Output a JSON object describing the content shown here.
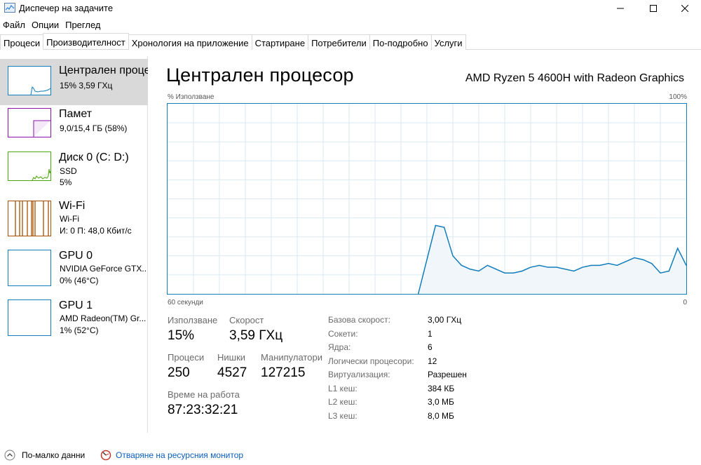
{
  "window": {
    "title": "Диспечер на задачите",
    "controls": [
      "minimize-icon",
      "maximize-icon",
      "close-icon"
    ]
  },
  "menu": [
    "Файл",
    "Опции",
    "Преглед"
  ],
  "tabs": [
    {
      "label": "Процеси",
      "active": false
    },
    {
      "label": "Производителност",
      "active": true
    },
    {
      "label": "Хронология на приложение",
      "active": false
    },
    {
      "label": "Стартиране",
      "active": false
    },
    {
      "label": "Потребители",
      "active": false
    },
    {
      "label": "По-подробно",
      "active": false
    },
    {
      "label": "Услуги",
      "active": false
    }
  ],
  "sidebar": {
    "items": [
      {
        "title": "Централен процесор",
        "line1": "15%  3,59 ГХц",
        "line2": "",
        "color": "#117dbb",
        "selected": true
      },
      {
        "title": "Памет",
        "line1": "9,0/15,4 ГБ (58%)",
        "line2": "",
        "color": "#8b12ae",
        "selected": false
      },
      {
        "title": "Диск 0 (C: D:)",
        "line1": "SSD",
        "line2": "5%",
        "color": "#4da60c",
        "selected": false
      },
      {
        "title": "Wi-Fi",
        "line1": "Wi-Fi",
        "line2": "И: 0 П: 48,0 Кбит/с",
        "color": "#a74f01",
        "selected": false
      },
      {
        "title": "GPU 0",
        "line1": "NVIDIA GeForce GTX...",
        "line2": "0%  (46°C)",
        "color": "#117dbb",
        "selected": false
      },
      {
        "title": "GPU 1",
        "line1": "AMD Radeon(TM) Gr...",
        "line2": "1%  (52°C)",
        "color": "#117dbb",
        "selected": false
      }
    ]
  },
  "main": {
    "title": "Централен процесор",
    "cpu_name": "AMD Ryzen 5 4600H with Radeon Graphics",
    "graph": {
      "y_label": "% Използване",
      "y_max_label": "100%",
      "x_left_label": "60 секунди",
      "x_right_label": "0",
      "line_color": "#117dbb",
      "fill_color": "#f1f6fa",
      "grid_color": "#d9eaf4"
    },
    "stats": {
      "usage_label": "Използване",
      "usage_value": "15%",
      "speed_label": "Скорост",
      "speed_value": "3,59 ГХц",
      "processes_label": "Процеси",
      "processes_value": "250",
      "threads_label": "Нишки",
      "threads_value": "4527",
      "handles_label": "Манипулатори",
      "handles_value": "127215",
      "uptime_label": "Време на работа",
      "uptime_value": "87:23:32:21"
    },
    "specs": [
      {
        "label": "Базова скорост:",
        "value": "3,00 ГХц"
      },
      {
        "label": "Сокети:",
        "value": "1"
      },
      {
        "label": "Ядра:",
        "value": "6"
      },
      {
        "label": "Логически процесори:",
        "value": "12"
      },
      {
        "label": "Виртуализация:",
        "value": "Разрешен"
      },
      {
        "label": "L1 кеш:",
        "value": "384 КБ"
      },
      {
        "label": "L2 кеш:",
        "value": "3,0 МБ"
      },
      {
        "label": "L3 кеш:",
        "value": "8,0 МБ"
      }
    ]
  },
  "chart_data": {
    "type": "area",
    "x_unit": "seconds ago",
    "x_range": [
      60,
      0
    ],
    "ylim": [
      0,
      100
    ],
    "ylabel": "% Използване",
    "x": [
      60,
      56,
      52,
      48,
      44,
      40,
      36,
      33,
      32,
      31,
      30,
      29,
      28,
      27,
      26,
      25,
      24,
      23,
      22,
      21,
      20,
      19,
      18,
      17,
      16,
      15,
      14,
      13,
      12,
      11,
      10,
      9,
      8,
      7,
      6,
      5,
      4,
      3,
      2,
      1,
      0
    ],
    "values": [
      null,
      null,
      null,
      null,
      null,
      null,
      null,
      null,
      null,
      0,
      18,
      36,
      35,
      20,
      15,
      13,
      12,
      15,
      13,
      11,
      11,
      12,
      14,
      15,
      14,
      14,
      13,
      12,
      14,
      15,
      15,
      16,
      15,
      17,
      19,
      18,
      16,
      11,
      12,
      24,
      15
    ]
  },
  "footer": {
    "fewer_details": "По-малко данни",
    "resource_monitor": "Отваряне на ресурсния монитор"
  }
}
